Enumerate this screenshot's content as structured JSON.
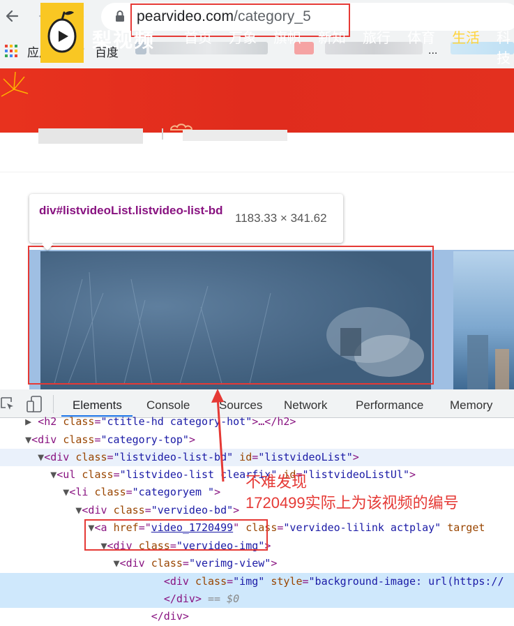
{
  "browser": {
    "url_host": "pearvideo.com",
    "url_path": "/category_5",
    "bookmarks": [
      {
        "label": "应用",
        "icon": "apps-grid-icon"
      },
      {
        "label": "百度",
        "icon": "baidu-paw-icon"
      }
    ],
    "bookmarks_overflow": "..."
  },
  "site": {
    "name": "梨视频",
    "nav": [
      "首页",
      "万象",
      "旗帜",
      "新知",
      "旅行",
      "体育",
      "生活",
      "科技"
    ],
    "active_nav": "生活"
  },
  "tooltip": {
    "selector_tag": "div",
    "selector_id": "#listvideoList",
    "selector_class": ".listvideo-list-bd",
    "size": "1183.33 × 341.62"
  },
  "devtools": {
    "tabs": [
      "Elements",
      "Console",
      "Sources",
      "Network",
      "Performance",
      "Memory"
    ],
    "active_tab": "Elements",
    "dom": [
      {
        "l1": "<h2 ",
        "an1": "class",
        "eq": "=",
        "av1": "\"ctitle-hd category-hot\"",
        "rest": ">…</h2>"
      },
      {
        "l1": "<div ",
        "an1": "class",
        "eq": "=",
        "av1": "\"category-top\"",
        "rest": ">"
      },
      {
        "l1": "<div ",
        "an1": "class",
        "eq": "=",
        "av1": "\"listvideo-list-bd\"",
        "an2": " id",
        "av2": "\"listvideoList\"",
        "rest": ">"
      },
      {
        "l1": "<ul ",
        "an1": "class",
        "eq": "=",
        "av1": "\"listvideo-list clearfix\"",
        "an2": " id",
        "av2": "\"listvideoListUl\"",
        "rest": ">"
      },
      {
        "l1": "<li ",
        "an1": "class",
        "eq": "=",
        "av1": "\"categoryem \"",
        "rest": ">"
      },
      {
        "l1": "<div ",
        "an1": "class",
        "eq": "=",
        "av1": "\"vervideo-bd\"",
        "rest": ">"
      },
      {
        "l1": "<a ",
        "an1": "href",
        "eq": "=",
        "av1": "video_1720499",
        "an2": " class",
        "av2": "\"vervideo-lilink actplay\"",
        "rest": " target"
      },
      {
        "l1": "<div ",
        "an1": "class",
        "eq": "=",
        "av1": "\"vervideo-img\"",
        "rest": ">"
      },
      {
        "l1": "<div ",
        "an1": "class",
        "eq": "=",
        "av1": "\"verimg-view\"",
        "rest": ">"
      },
      {
        "l1": "<div ",
        "an1": "class",
        "eq": "=",
        "av1": "\"img\"",
        "an2": " style",
        "av2": "\"background-image: url(https://",
        "rest": ""
      },
      {
        "l1": "</div>",
        "rest": " == $0"
      },
      {
        "l1": "</div>",
        "rest": ""
      }
    ]
  },
  "annotation": {
    "line1": "不难发现",
    "line2": "1720499实际上为该视频的编号"
  },
  "colors": {
    "header_red": "#e3301f",
    "active_nav": "#ffd43b",
    "annotation_red": "#e53935",
    "devtools_accent": "#1a73e8"
  }
}
